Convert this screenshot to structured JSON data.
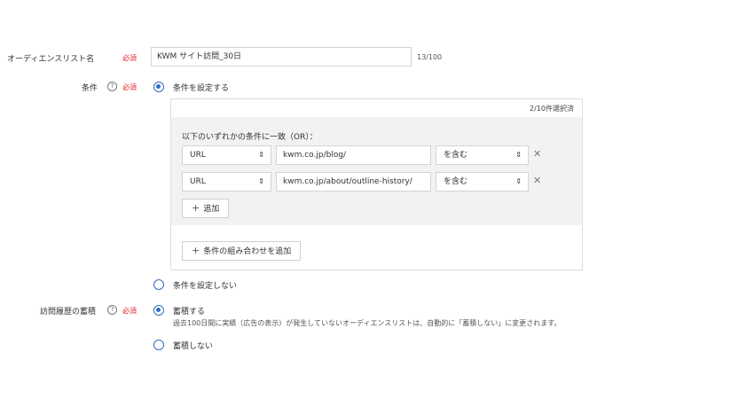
{
  "audience_name": {
    "label": "オーディエンスリスト名",
    "required": "必須",
    "value": "KWM サイト訪問_30日",
    "counter": "13/100"
  },
  "conditions": {
    "label": "条件",
    "help": "?",
    "required": "必須",
    "option_set": "条件を設定する",
    "option_none": "条件を設定しない",
    "selected_count": "2/10件選択済",
    "group_title": "以下のいずれかの条件に一致（OR）：",
    "rows": [
      {
        "type": "URL",
        "value": "kwm.co.jp/blog/",
        "match": "を含む"
      },
      {
        "type": "URL",
        "value": "kwm.co.jp/about/outline-history/",
        "match": "を含む"
      }
    ],
    "add_label": "追加",
    "add_group_label": "条件の組み合わせを追加",
    "selected": "set"
  },
  "history": {
    "label": "訪問履歴の蓄積",
    "help": "?",
    "required": "必須",
    "option_store": "蓄積する",
    "option_store_note": "過去100日間に実績（広告の表示）が発生していないオーディエンスリストは、自動的に「蓄積しない」に変更されます。",
    "option_nostore": "蓄積しない",
    "selected": "store"
  },
  "colors": {
    "accent": "#2f6fbf",
    "required": "#e0202a",
    "panel_bg": "#f2f2f2"
  }
}
